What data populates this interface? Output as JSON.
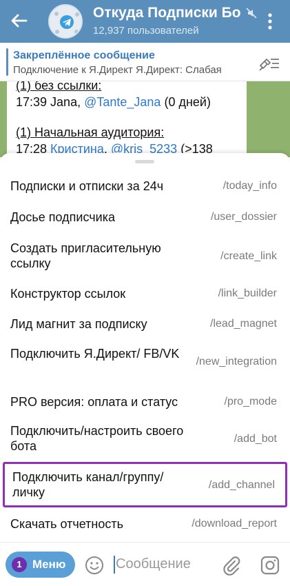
{
  "header": {
    "title": "Откуда Подписки Бо",
    "subtitle": "12,937 пользователей"
  },
  "pinned": {
    "title": "Закреплённое сообщение",
    "text": "Подключение к Я.Директ Я.Директ: Слабая"
  },
  "message": {
    "line1": "(1) без ссылки:",
    "line2_time": "17:39 Jana, ",
    "line2_link": "@Tante_Jana",
    "line2_tail": " (0 дней)",
    "line3": "(1) Начальная аудитория:",
    "line4_time": "17:28 ",
    "line4_name": "Кристина",
    "line4_sep": ", ",
    "line4_link": "@kris_5233",
    "line4_tail": " (>138"
  },
  "commands": [
    {
      "label": "Подписки и отписки за 24ч",
      "command": "/today_info"
    },
    {
      "label": "Досье подписчика",
      "command": "/user_dossier"
    },
    {
      "label": "Создать пригласительную ссылку",
      "command": "/create_link"
    },
    {
      "label": "Конструктор ссылок",
      "command": "/link_builder"
    },
    {
      "label": "Лид магнит за подписку",
      "command": "/lead_magnet"
    },
    {
      "label": "Подключить Я.Директ/ FB/VK",
      "command": "/new_integration"
    },
    {
      "label": "PRO версия: оплата и статус",
      "command": "/pro_mode"
    },
    {
      "label": "Подключить/настроить своего бота",
      "command": "/add_bot"
    },
    {
      "label": "Подключить канал/группу/ личку",
      "command": "/add_channel"
    },
    {
      "label": "Скачать отчетность",
      "command": "/download_report"
    }
  ],
  "input": {
    "menu_label": "Меню",
    "menu_badge": "1",
    "placeholder": "Сообщение"
  },
  "colors": {
    "header": "#5a8fbb",
    "link": "#2f7ac8",
    "highlight": "#8e2fb6",
    "menu_button": "#5a9fd6"
  },
  "icons": [
    "back-arrow-icon",
    "telegram-avatar-icon",
    "mute-icon",
    "kebab-menu-icon",
    "pin-list-icon",
    "smile-icon",
    "paperclip-icon",
    "camera-icon"
  ]
}
